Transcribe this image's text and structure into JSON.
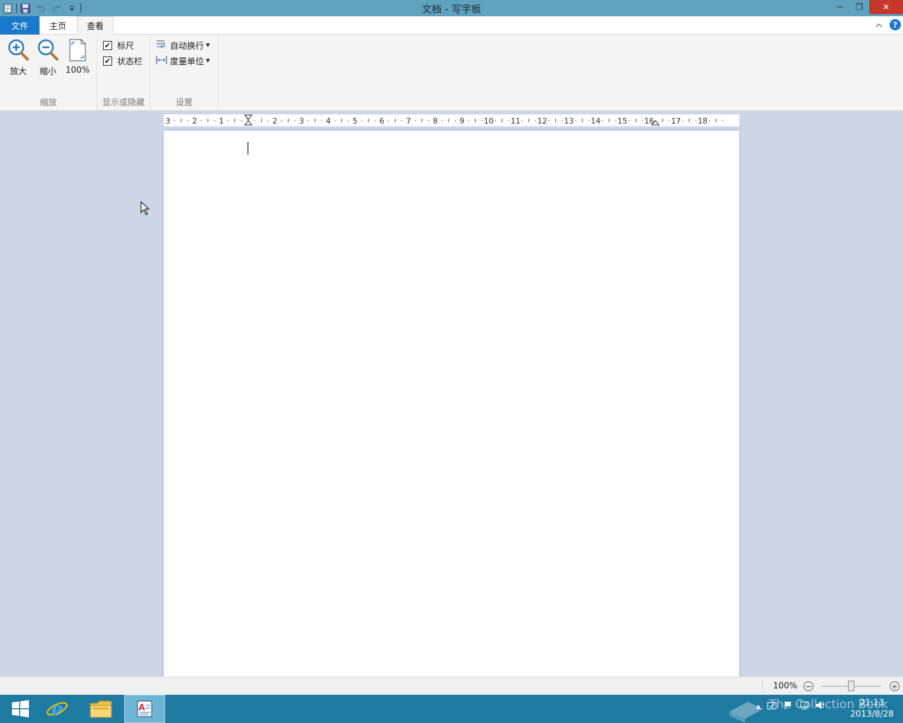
{
  "window": {
    "title": "文档 - 写字板",
    "controls": {
      "minimize": "─",
      "maximize": "❐",
      "close": "✕"
    }
  },
  "quick_access": [
    "wordpad-app-icon",
    "save-icon",
    "undo-icon",
    "redo-icon",
    "customize-qat-icon"
  ],
  "tabs": {
    "file": "文件",
    "home": "主页",
    "view": "查看"
  },
  "help_glyph": "?",
  "ribbon": {
    "zoom": {
      "zoom_in": "放大",
      "zoom_out": "缩小",
      "hundred": "100%",
      "group_label": "缩放"
    },
    "show_hide": {
      "ruler": "标尺",
      "ruler_checked": true,
      "statusbar": "状态栏",
      "statusbar_checked": true,
      "check_glyph": "✔",
      "group_label": "显示或隐藏"
    },
    "settings": {
      "word_wrap": "自动换行",
      "measure_units": "度量单位",
      "dropdown_glyph": "▼",
      "group_label": "设置"
    }
  },
  "ruler": {
    "labels": [
      "3",
      "2",
      "1",
      "1",
      "2",
      "3",
      "4",
      "5",
      "6",
      "7",
      "8",
      "9",
      "10",
      "11",
      "12",
      "13",
      "14",
      "15",
      "16",
      "17",
      "18"
    ]
  },
  "status": {
    "zoom": "100%",
    "zoom_out_glyph": "−",
    "zoom_in_glyph": "+",
    "zoom_level": 100
  },
  "taskbar": {
    "time": "21:13",
    "date": "2013/8/28",
    "watermark": "The Collection Book",
    "tray_up_glyph": "▲"
  },
  "colors": {
    "titlebar": "#5fa2bf",
    "file_tab": "#1979ca",
    "close": "#c8372c",
    "taskbar": "#1f7aa2",
    "workspace": "#ccd6e6"
  }
}
